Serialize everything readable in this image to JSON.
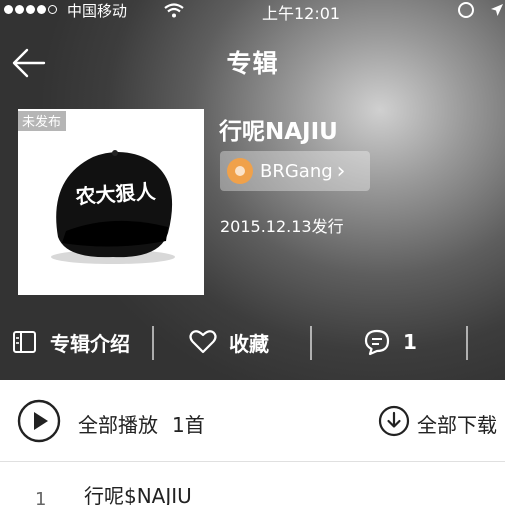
{
  "status": {
    "carrier": "中国移动",
    "time": "上午12:01"
  },
  "nav": {
    "title": "专辑"
  },
  "album": {
    "badge": "未发布",
    "name": "行呢NAJIU",
    "artist": "BRGang",
    "release": "2015.12.13发行",
    "cap_text": "农大狠人"
  },
  "actions": {
    "intro": "专辑介绍",
    "collect": "收藏",
    "comments": "1"
  },
  "playbar": {
    "play_all": "全部播放",
    "count": "1首",
    "download_all": "全部下载"
  },
  "songs": [
    {
      "index": "1",
      "title": "行呢$NAJIU"
    }
  ],
  "colors": {
    "accent_disc": "#f0a14a"
  }
}
